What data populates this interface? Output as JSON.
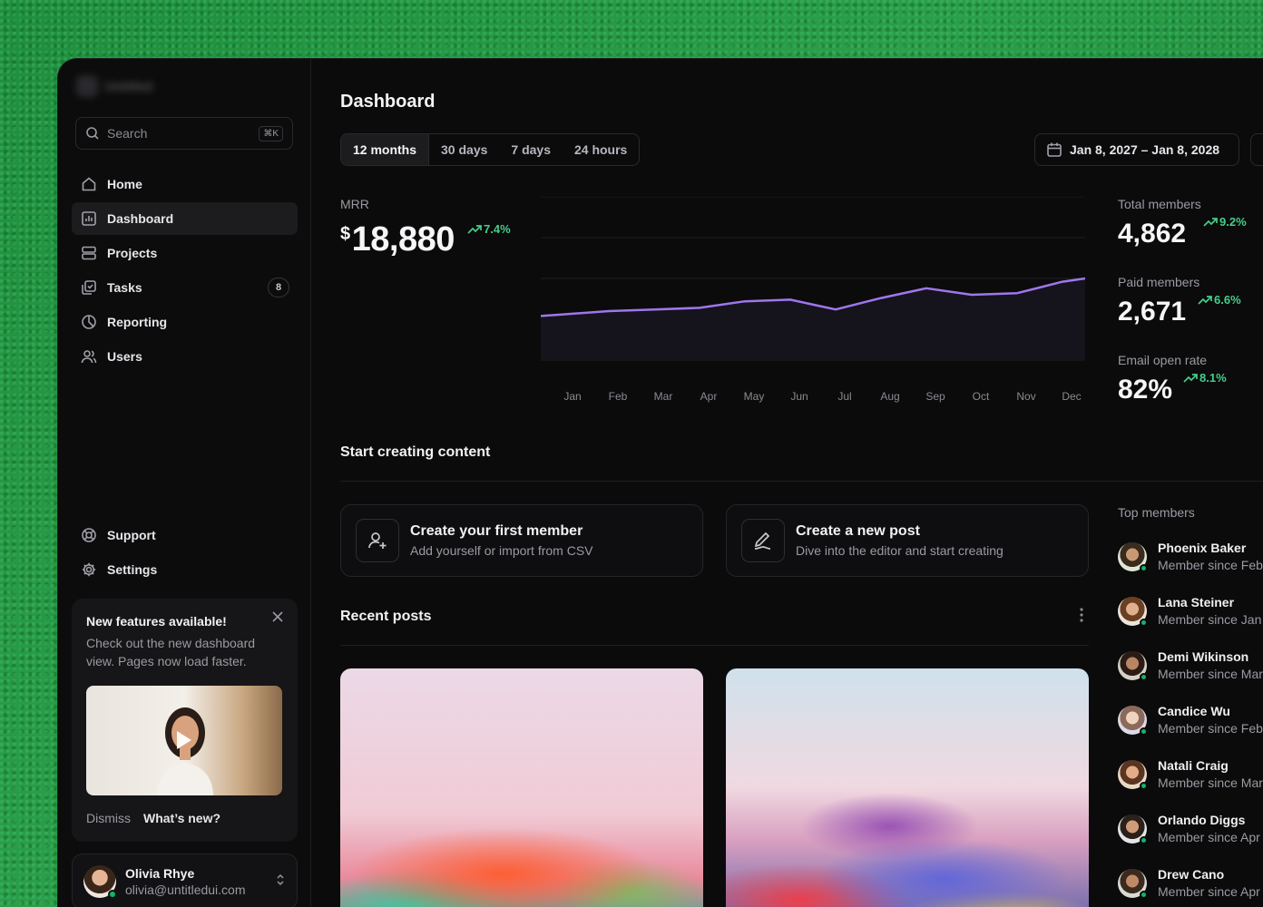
{
  "sidebar": {
    "brand": "Untitled",
    "search": {
      "placeholder": "Search",
      "shortcut": "⌘K"
    },
    "nav": [
      {
        "label": "Home",
        "icon": "home-icon"
      },
      {
        "label": "Dashboard",
        "icon": "bar-chart-icon",
        "active": true
      },
      {
        "label": "Projects",
        "icon": "layers-icon"
      },
      {
        "label": "Tasks",
        "icon": "check-square-icon",
        "badge": "8"
      },
      {
        "label": "Reporting",
        "icon": "pie-chart-icon"
      },
      {
        "label": "Users",
        "icon": "users-icon"
      }
    ],
    "bottom_nav": [
      {
        "label": "Support",
        "icon": "life-buoy-icon"
      },
      {
        "label": "Settings",
        "icon": "gear-icon"
      }
    ],
    "feature_card": {
      "title": "New features available!",
      "body": "Check out the new dashboard view. Pages now load faster.",
      "dismiss": "Dismiss",
      "whats_new": "What’s new?"
    },
    "user": {
      "name": "Olivia Rhye",
      "email": "olivia@untitledui.com"
    }
  },
  "header": {
    "title": "Dashboard",
    "ranges": [
      "12 months",
      "30 days",
      "7 days",
      "24 hours"
    ],
    "active_range": "12 months",
    "date_range": "Jan 8, 2027 – Jan 8, 2028"
  },
  "mrr": {
    "label": "MRR",
    "currency": "$",
    "value": "18,880",
    "change": "7.4%"
  },
  "chart_data": {
    "type": "area",
    "categories": [
      "Jan",
      "Feb",
      "Mar",
      "Apr",
      "May",
      "Jun",
      "Jul",
      "Aug",
      "Sep",
      "Oct",
      "Nov",
      "Dec"
    ],
    "series": [
      {
        "values": [
          28,
          30,
          31,
          32,
          36,
          37,
          31,
          38,
          44,
          40,
          41,
          48
        ]
      }
    ],
    "ylim": [
      0,
      100
    ],
    "grid": true,
    "colors": {
      "line": "#9e77ed",
      "fill": "#15131c",
      "grid": "#1f1f23"
    }
  },
  "stats": [
    {
      "label": "Total members",
      "value": "4,862",
      "change": "9.2%"
    },
    {
      "label": "Paid members",
      "value": "2,671",
      "change": "6.6%"
    },
    {
      "label": "Email open rate",
      "value": "82%",
      "change": "8.1%"
    }
  ],
  "content": {
    "title": "Start creating content",
    "cards": [
      {
        "title": "Create your first member",
        "desc": "Add yourself or import from CSV",
        "icon": "user-plus-icon"
      },
      {
        "title": "Create a new post",
        "desc": "Dive into the editor and start creating",
        "icon": "pen-icon"
      }
    ]
  },
  "recent_posts": {
    "title": "Recent posts"
  },
  "top_members": {
    "title": "Top members",
    "members": [
      {
        "name": "Phoenix Baker",
        "since": "Member since Feb"
      },
      {
        "name": "Lana Steiner",
        "since": "Member since Jan"
      },
      {
        "name": "Demi Wikinson",
        "since": "Member since Mar"
      },
      {
        "name": "Candice Wu",
        "since": "Member since Feb"
      },
      {
        "name": "Natali Craig",
        "since": "Member since Mar"
      },
      {
        "name": "Orlando Diggs",
        "since": "Member since Apr"
      },
      {
        "name": "Drew Cano",
        "since": "Member since Apr"
      }
    ]
  },
  "colors": {
    "accent": "#9e77ed",
    "positive": "#47cd89",
    "online": "#17b26a",
    "background": "#0b0b0c"
  }
}
